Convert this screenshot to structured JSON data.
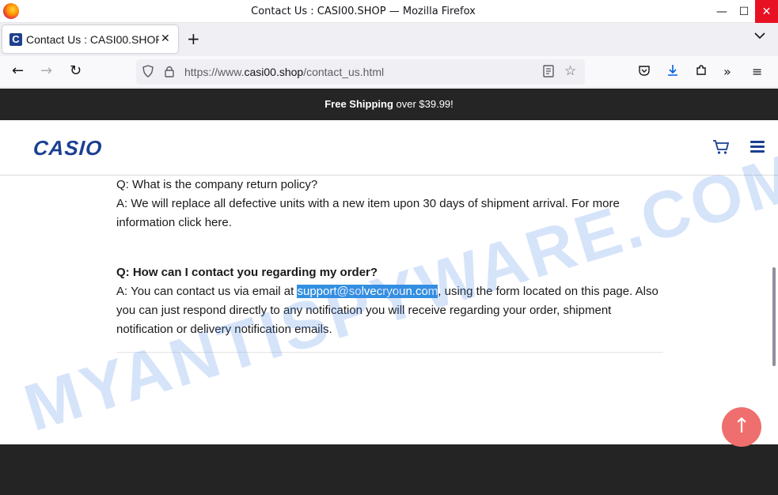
{
  "window": {
    "title": "Contact Us : CASI00.SHOP — Mozilla Firefox",
    "minimize": "—",
    "maximize": "☐",
    "close": "✕"
  },
  "tab": {
    "favicon": "C",
    "title": "Contact Us : CASI00.SHOP",
    "close": "✕",
    "new_tab": "+",
    "list_all_tabs": "⌄"
  },
  "nav": {
    "back": "←",
    "forward": "→",
    "reload": "↻",
    "url_prefix": "https://www.",
    "url_domain": "casi00.shop",
    "url_path": "/contact_us.html",
    "icons": [
      "shield-icon",
      "lock-icon",
      "reader-view-icon",
      "bookmark-star-icon",
      "pocket-icon",
      "download-icon",
      "extensions-icon",
      "overflow-icon",
      "app-menu-icon"
    ]
  },
  "promo": {
    "bold": "Free Shipping",
    "rest": " over $39.99!"
  },
  "header": {
    "logo": "CASIO",
    "cart": "🛒"
  },
  "faq": {
    "q1": "Q: What is the company return policy?",
    "a1": "A: We will replace all defective units with a new item upon 30 days of shipment arrival. For more information click here.",
    "q2": "Q: How can I contact you regarding my order?",
    "a2_pre": "A: You can contact us via email at ",
    "a2_email": "support@solvecryoun.com",
    "a2_post": ", using the form located on this page. Also you can just respond directly to any notification you will receive regarding your order, shipment notification or delivery notification emails."
  },
  "back_to_top": "↑",
  "watermark": "MYANTISPYWARE.COM",
  "colors": {
    "brand": "#1b3f92",
    "promo_bg": "#252525",
    "selection": "#3390e0",
    "back_to_top": "#ef6e6e"
  }
}
